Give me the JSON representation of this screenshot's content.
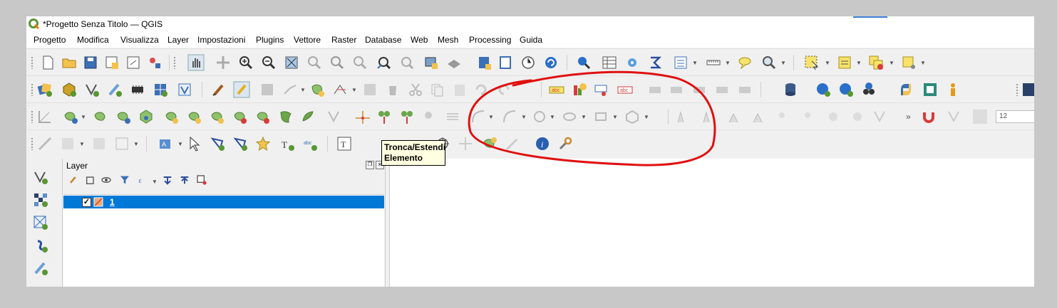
{
  "window": {
    "title": "*Progetto Senza Titolo — QGIS"
  },
  "menubar": {
    "items": [
      {
        "label": "Progetto"
      },
      {
        "label": "Modifica"
      },
      {
        "label": "Visualizza"
      },
      {
        "label": "Layer"
      },
      {
        "label": "Impostazioni"
      },
      {
        "label": "Plugins"
      },
      {
        "label": "Vettore"
      },
      {
        "label": "Raster"
      },
      {
        "label": "Database"
      },
      {
        "label": "Web"
      },
      {
        "label": "Mesh"
      },
      {
        "label": "Processing"
      },
      {
        "label": "Guida"
      }
    ]
  },
  "digitizing": {
    "font_size_value": "12"
  },
  "tooltip": {
    "line1": "Tronca/Estendi",
    "line2": "Elemento"
  },
  "layers_panel": {
    "title": "Layer",
    "layers": [
      {
        "name": "1",
        "checked": true,
        "selected": true
      }
    ]
  },
  "colors": {
    "selection": "#0078d7",
    "annotation": "#e01010",
    "toolbar_bg": "#f0f0f0"
  }
}
